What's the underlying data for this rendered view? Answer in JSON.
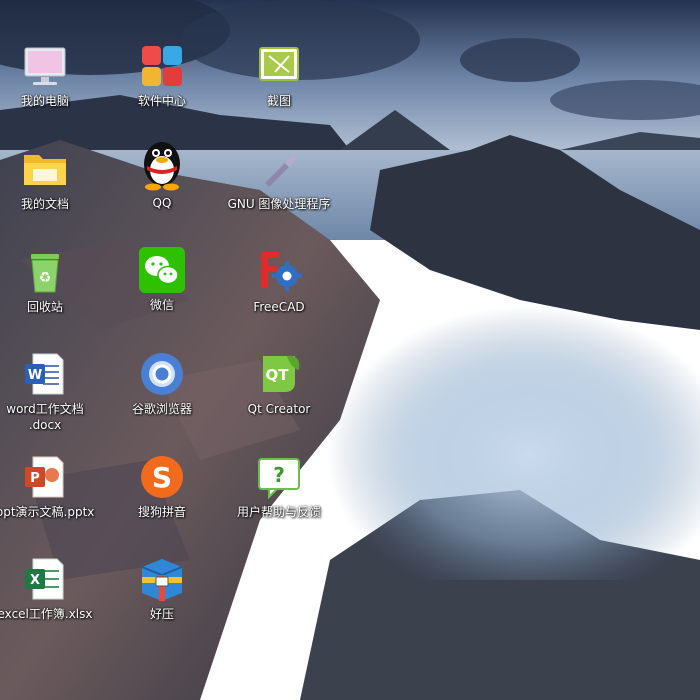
{
  "desktop": {
    "icons": [
      {
        "label": "我的电脑",
        "label2": "",
        "icon": "computer-icon"
      },
      {
        "label": "我的文档",
        "label2": "",
        "icon": "folder-icon"
      },
      {
        "label": "回收站",
        "label2": "",
        "icon": "recycle-bin-icon"
      },
      {
        "label": "word工作文档",
        "label2": ".docx",
        "icon": "word-document-icon"
      },
      {
        "label": "ppt演示文稿.pptx",
        "label2": "",
        "icon": "ppt-document-icon"
      },
      {
        "label": "excel工作簿.xlsx",
        "label2": "",
        "icon": "excel-document-icon"
      },
      {
        "label": "软件中心",
        "label2": "",
        "icon": "software-center-icon"
      },
      {
        "label": "QQ",
        "label2": "",
        "icon": "qq-penguin-icon"
      },
      {
        "label": "微信",
        "label2": "",
        "icon": "wechat-icon"
      },
      {
        "label": "谷歌浏览器",
        "label2": "",
        "icon": "chrome-browser-icon"
      },
      {
        "label": "搜狗拼音",
        "label2": "",
        "icon": "sogou-pinyin-icon"
      },
      {
        "label": "好压",
        "label2": "",
        "icon": "haozip-icon"
      },
      {
        "label": "截图",
        "label2": "",
        "icon": "screenshot-icon"
      },
      {
        "label": "GNU 图像处理程序",
        "label2": "",
        "icon": "gimp-icon"
      },
      {
        "label": "FreeCAD",
        "label2": "",
        "icon": "freecad-icon"
      },
      {
        "label": "Qt Creator",
        "label2": "",
        "icon": "qt-creator-icon"
      },
      {
        "label": "用户帮助与反馈",
        "label2": "",
        "icon": "user-help-feedback-icon"
      }
    ]
  },
  "colors": {
    "sky": "#3b4a66",
    "sea": "#7f98b8",
    "rock": "#4a4e5c",
    "label_text": "#ffffff"
  }
}
